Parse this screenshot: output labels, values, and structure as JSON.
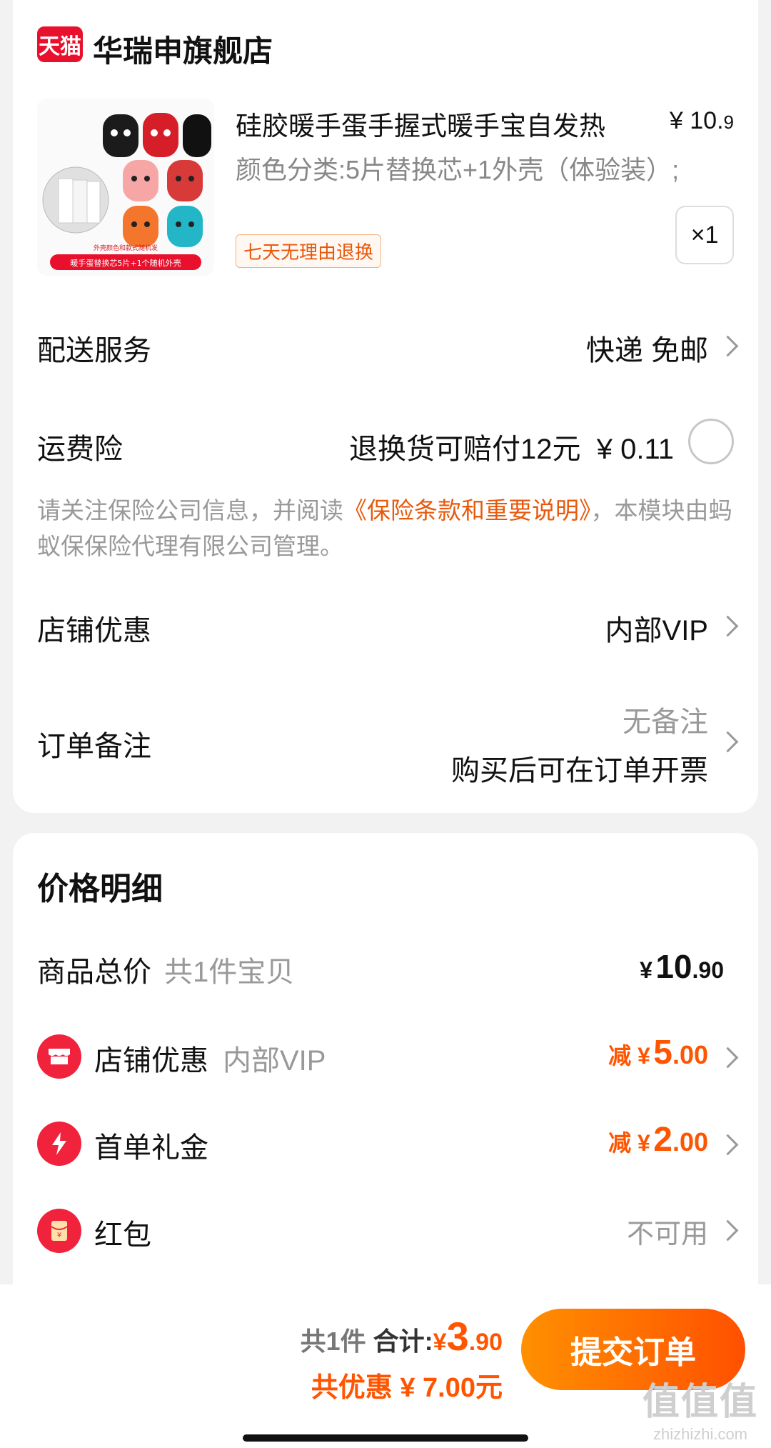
{
  "store": {
    "logo": "天猫",
    "name": "华瑞申旗舰店"
  },
  "product": {
    "title": "硅胶暖手蛋手握式暖手宝自发热",
    "price_main": "¥ 10.",
    "price_dec": "9",
    "sku": "颜色分类:5片替换芯+1外壳（体验装）;",
    "tag": "七天无理由退换",
    "quantity": "×1",
    "image_caption_top": "外壳颜色和款式随机发",
    "image_caption": "暖手蛋替换芯5片+1个随机外壳"
  },
  "delivery": {
    "label": "配送服务",
    "value": "快递 免邮"
  },
  "insurance": {
    "label": "运费险",
    "value": "退换货可赔付12元",
    "price": "¥ 0.11",
    "notice_pre": "请关注保险公司信息，并阅读",
    "notice_link": "《保险条款和重要说明》",
    "notice_post": "，本模块由蚂蚁保保险代理有限公司管理。"
  },
  "shop_discount": {
    "label": "店铺优惠",
    "value": "内部VIP"
  },
  "remark": {
    "label": "订单备注",
    "value1": "无备注",
    "value2": "购买后可在订单开票"
  },
  "price_detail": {
    "title": "价格明细",
    "total_label": "商品总价",
    "total_sub": "共1件宝贝",
    "total_yen": "¥",
    "total_int": "10",
    "total_dec": ".90",
    "shop_label": "店铺优惠",
    "shop_sub": "内部VIP",
    "shop_prefix": "减 ¥",
    "shop_int": "5",
    "shop_dec": ".00",
    "first_label": "首单礼金",
    "first_prefix": "减 ¥",
    "first_int": "2",
    "first_dec": ".00",
    "redpacket_label": "红包",
    "redpacket_value": "不可用"
  },
  "bottom": {
    "count": "共1件",
    "total_label": "合计:",
    "yen": "¥",
    "total_int": "3",
    "total_dec": ".90",
    "saved": "共优惠 ¥ 7.00元",
    "submit": "提交订单"
  },
  "watermark": {
    "logo": "值值值",
    "url": "zhizhizhi.com"
  },
  "colors": {
    "accent": "#ff5500",
    "tmall_red": "#e8102d",
    "muted": "#999999"
  }
}
